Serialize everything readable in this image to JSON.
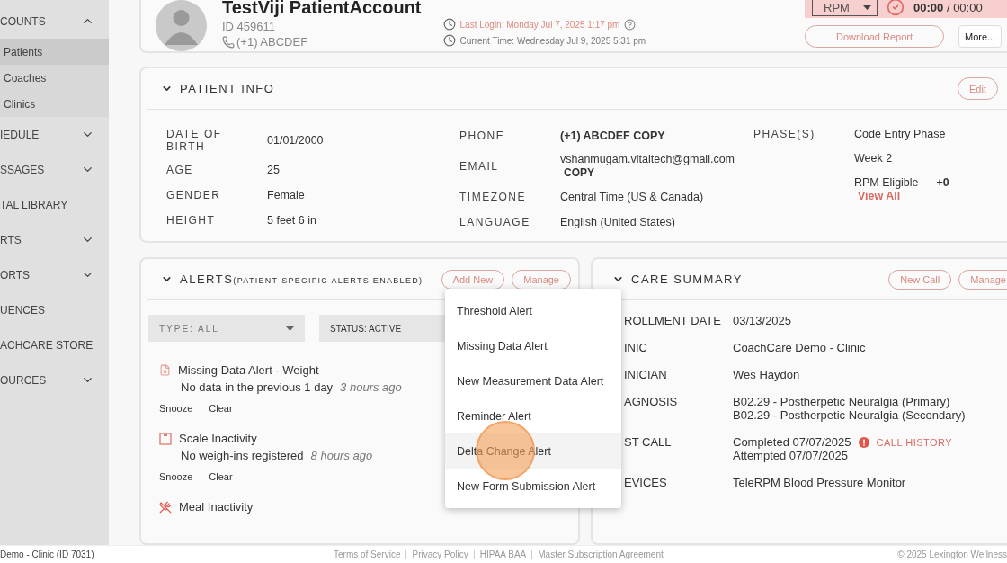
{
  "sidebar": {
    "items": [
      {
        "label": "COUNTS",
        "kind": "group",
        "expanded": true,
        "children": [
          {
            "label": "Patients",
            "selected": true
          },
          {
            "label": "Coaches",
            "selected": false
          },
          {
            "label": "Clinics",
            "selected": false
          }
        ]
      },
      {
        "label": "IEDULE",
        "kind": "group",
        "expanded": false
      },
      {
        "label": "SSAGES",
        "kind": "group",
        "expanded": false
      },
      {
        "label": "TAL LIBRARY",
        "kind": "link"
      },
      {
        "label": "RTS",
        "kind": "group",
        "expanded": false
      },
      {
        "label": "ORTS",
        "kind": "group",
        "expanded": false
      },
      {
        "label": "UENCES",
        "kind": "link"
      },
      {
        "label": "ACHCARE STORE",
        "kind": "link"
      },
      {
        "label": "OURCES",
        "kind": "group",
        "expanded": false
      }
    ]
  },
  "patient": {
    "name": "TestViji PatientAccount",
    "id": "ID 459611",
    "phone": "(+1) ABCDEF",
    "last_login": "Last Login: Monday Jul 7, 2025 1:17 pm",
    "current_time": "Current Time: Wednesday Jul 9, 2025 5:31 pm"
  },
  "timer": {
    "program": "RPM",
    "elapsed": "00:00",
    "separator": "/",
    "total": "00:00"
  },
  "header_buttons": [
    "Download Report",
    "More..."
  ],
  "patient_info": {
    "title": "PATIENT INFO",
    "edit": "Edit",
    "columns": [
      [
        {
          "label": "DATE OF BIRTH",
          "value": "01/01/2000"
        },
        {
          "label": "AGE",
          "value": "25"
        },
        {
          "label": "GENDER",
          "value": "Female"
        },
        {
          "label": "HEIGHT",
          "value": "5 feet 6 in"
        }
      ],
      [
        {
          "label": "PHONE",
          "value": "(+1) ABCDEF COPY",
          "bold": true
        },
        {
          "label": "EMAIL",
          "value": "vshanmugam.vitaltech@gmail.com",
          "copy": "COPY"
        },
        {
          "label": "TIMEZONE",
          "value": "Central Time (US & Canada)"
        },
        {
          "label": "LANGUAGE",
          "value": "English (United States)"
        }
      ]
    ],
    "phases_label": "PHASE(S)",
    "phases": [
      "Code Entry Phase",
      "Week 2"
    ],
    "eligible": "RPM Eligible",
    "eligible_count": "+0",
    "view_all": "View All"
  },
  "alerts": {
    "title": "ALERTS",
    "subtitle": "(PATIENT-SPECIFIC ALERTS ENABLED)",
    "add": "Add New",
    "manage": "Manage",
    "filters": [
      {
        "label": "TYPE: ALL",
        "kind": "select"
      },
      {
        "label": "STATUS: ACTIVE",
        "kind": "select"
      }
    ],
    "items": [
      {
        "kind": "missing",
        "title": "Missing Data Alert - Weight",
        "detail": "No data in the previous 1 day",
        "time": "3 hours ago",
        "actions": [
          "Snooze",
          "Clear"
        ]
      },
      {
        "kind": "scale",
        "title": "Scale Inactivity",
        "detail": "No weigh-ins registered",
        "time": "8 hours ago",
        "actions": [
          "Snooze",
          "Clear"
        ]
      },
      {
        "kind": "meal",
        "title": "Meal Inactivity"
      }
    ],
    "menu": [
      {
        "label": "Threshold Alert",
        "selected": false
      },
      {
        "label": "Missing Data Alert",
        "selected": false
      },
      {
        "label": "New Measurement Data Alert",
        "selected": false
      },
      {
        "label": "Reminder Alert",
        "selected": false
      },
      {
        "label": "Delta Change Alert",
        "selected": true
      },
      {
        "label": "New Form Submission Alert",
        "selected": false
      }
    ]
  },
  "care_summary": {
    "title": "CARE SUMMARY",
    "buttons": [
      "New Call",
      "Manage"
    ],
    "rows": [
      {
        "label": "ROLLMENT DATE",
        "values": [
          "03/13/2025"
        ]
      },
      {
        "label": "INIC",
        "values": [
          "CoachCare Demo - Clinic"
        ]
      },
      {
        "label": "INICIAN",
        "values": [
          "Wes Haydon"
        ]
      },
      {
        "label": "AGNOSIS",
        "values": [
          "B02.29 - Postherpetic Neuralgia (Primary)",
          "B02.29 - Postherpetic Neuralgia (Secondary)"
        ]
      },
      {
        "label": "ST CALL",
        "values": [
          "Completed 07/07/2025",
          "Attempted 07/07/2025"
        ],
        "link": "CALL HISTORY"
      },
      {
        "label": "EVICES",
        "values": [
          "TeleRPM Blood Pressure Monitor"
        ]
      }
    ]
  },
  "footer": {
    "clinic": "Demo - Clinic (ID 7031)",
    "links": [
      "Terms of Service",
      "Privacy Policy",
      "HIPAA BAA",
      "Master Subscription Agreement"
    ],
    "copyright": "© 2025 Lexington Wellness"
  }
}
